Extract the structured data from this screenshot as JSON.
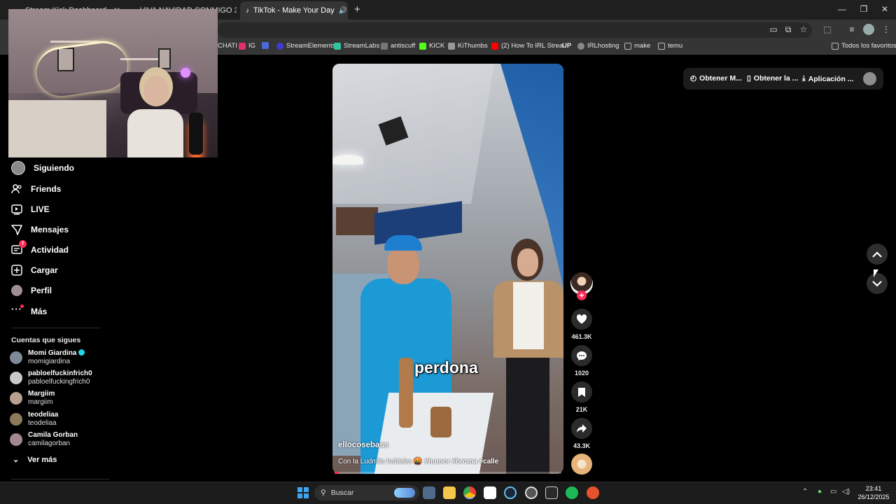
{
  "browser": {
    "tabs": [
      {
        "label": "Stream Kick Dashboard",
        "active": false
      },
      {
        "label": "VIVA NAVIDAD CONMIGO 375",
        "active": false
      },
      {
        "label": "TikTok - Make Your Day",
        "active": true
      }
    ],
    "new_tab": "+",
    "window_controls": {
      "minimize": "—",
      "maximize": "❐",
      "close": "✕"
    },
    "bookmarks": [
      {
        "label": "CHATI",
        "color": "#444"
      },
      {
        "label": "IG",
        "color": "#e1306c"
      },
      {
        "label": "",
        "color": "#4a6ad8"
      },
      {
        "label": "StreamElements",
        "color": "#3c3cd6"
      },
      {
        "label": "StreamLabs",
        "color": "#31c3a2"
      },
      {
        "label": "antiscuff",
        "color": "#777"
      },
      {
        "label": "KICK",
        "color": "#53fc18"
      },
      {
        "label": "KiThumbs",
        "color": "#999"
      },
      {
        "label": "(2) How To IRL Strea...",
        "color": "#ff0000"
      },
      {
        "label": "UP",
        "color": "#111"
      },
      {
        "label": "IRLhosting",
        "color": "#888"
      },
      {
        "label": "make",
        "color": "#bbb"
      },
      {
        "label": "temu",
        "color": "#bbb"
      }
    ],
    "all_bookmarks": "Todos los favoritos"
  },
  "sidebar": {
    "items": [
      {
        "label": "Siguiendo",
        "icon": "following-avatar-icon"
      },
      {
        "label": "Friends",
        "icon": "friends-icon"
      },
      {
        "label": "LIVE",
        "icon": "live-icon"
      },
      {
        "label": "Mensajes",
        "icon": "messages-icon"
      },
      {
        "label": "Actividad",
        "icon": "activity-icon",
        "badge": "7"
      },
      {
        "label": "Cargar",
        "icon": "upload-icon"
      },
      {
        "label": "Perfil",
        "icon": "profile-icon"
      },
      {
        "label": "Más",
        "icon": "more-icon"
      }
    ],
    "following_heading": "Cuentas que sigues",
    "following": [
      {
        "name": "Momi Giardina",
        "username": "momigiardina",
        "verified": true
      },
      {
        "name": "pabloelfuckinfrich0",
        "username": "pabloelfuckingfrich0",
        "verified": false
      },
      {
        "name": "Margiim",
        "username": "margiim",
        "verified": false
      },
      {
        "name": "teodeliaa",
        "username": "teodeliaa",
        "verified": false
      },
      {
        "name": "Camila Gorban",
        "username": "camilagorban",
        "verified": false
      }
    ],
    "see_more": "Ver más"
  },
  "video": {
    "subtitle": "perdona",
    "author": "ellocosebass",
    "description_prefix": "Con la Ludmila hablaba 🤬",
    "hashtags": "#humor #broma #calle",
    "progress": 0.02,
    "likes": "461.3K",
    "comments": "1020",
    "saves": "21K",
    "shares": "43.3K"
  },
  "topbar": {
    "get_coins": "Obtener M...",
    "get_app": "Obtener la ...",
    "desktop_app": "Aplicación ..."
  },
  "taskbar": {
    "search_placeholder": "Buscar",
    "time": "23:41",
    "date": "26/12/2025"
  },
  "colors": {
    "accent": "#fe2c55",
    "verified": "#20d5ec"
  }
}
